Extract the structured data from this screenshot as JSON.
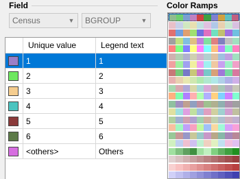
{
  "field": {
    "title": "Field",
    "layer_value": "Census",
    "field_value": "BGROUP"
  },
  "ramps": {
    "title": "Color Ramps"
  },
  "table": {
    "col_value": "Unique value",
    "col_legend": "Legend text",
    "rows": [
      {
        "value": "1",
        "legend": "1",
        "color": "#9b7fc8"
      },
      {
        "value": "2",
        "legend": "2",
        "color": "#6ee860"
      },
      {
        "value": "3",
        "legend": "3",
        "color": "#f5cd8f"
      },
      {
        "value": "4",
        "legend": "4",
        "color": "#4cc4c0"
      },
      {
        "value": "5",
        "legend": "5",
        "color": "#8a3a3a"
      },
      {
        "value": "6",
        "legend": "6",
        "color": "#5c7a48"
      },
      {
        "value": "<others>",
        "legend": "Others",
        "color": "#d66ee0"
      }
    ],
    "selected_row": 0
  }
}
